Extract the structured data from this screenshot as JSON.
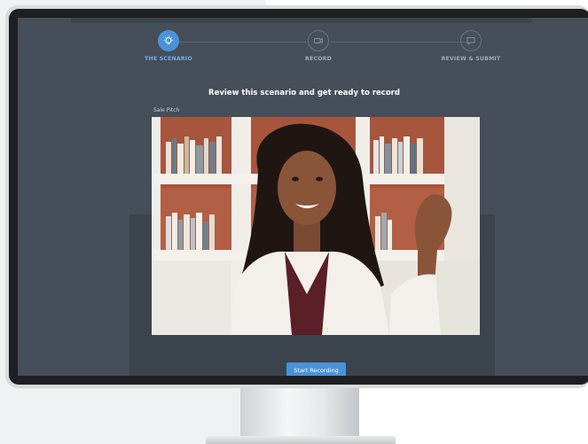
{
  "stepper": {
    "steps": [
      {
        "label": "THE SCENARIO",
        "icon": "lightbulb-icon",
        "active": true
      },
      {
        "label": "RECORD",
        "icon": "video-camera-icon",
        "active": false
      },
      {
        "label": "REVIEW & SUBMIT",
        "icon": "chat-bubble-icon",
        "active": false
      }
    ]
  },
  "main": {
    "title": "Review this scenario and get ready to record",
    "scenario_label": "Sale Pitch",
    "record_button": "Start Recording"
  },
  "colors": {
    "accent": "#4a93d6",
    "screen_bg": "#454e59",
    "frame": "#1d1f22"
  }
}
